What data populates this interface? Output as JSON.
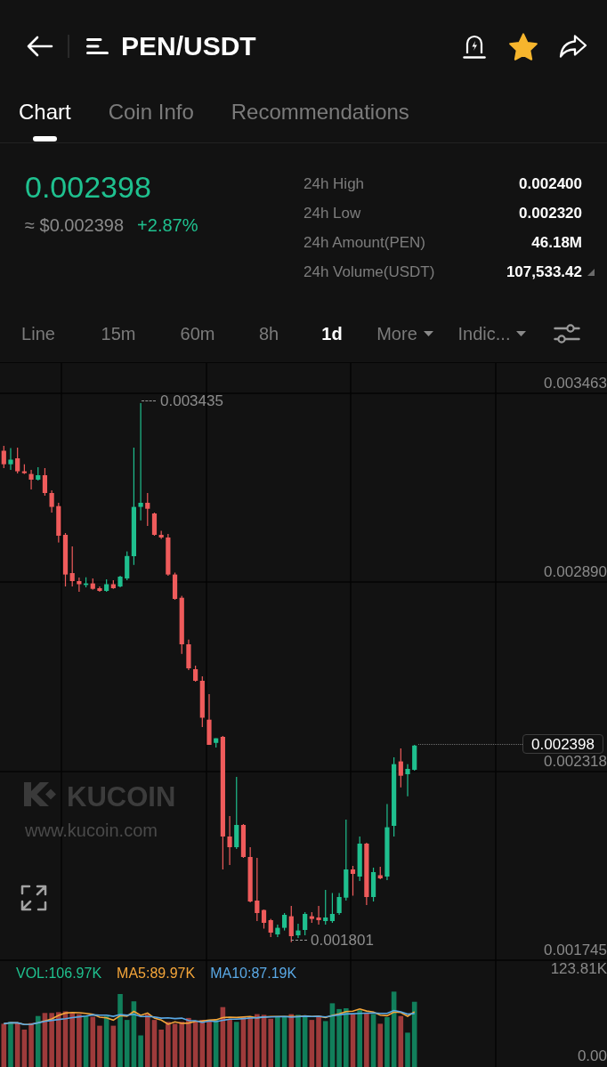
{
  "header": {
    "title": "PEN/USDT",
    "favorite": true
  },
  "tabs": [
    {
      "label": "Chart",
      "selected": true
    },
    {
      "label": "Coin Info",
      "selected": false
    },
    {
      "label": "Recommendations",
      "selected": false
    }
  ],
  "ticker": {
    "price": "0.002398",
    "fiat_price": "≈ $0.002398",
    "change": "+2.87%"
  },
  "stats": [
    {
      "label": "24h High",
      "value": "0.002400",
      "toggle": false
    },
    {
      "label": "24h Low",
      "value": "0.002320",
      "toggle": false
    },
    {
      "label": "24h Amount(PEN)",
      "value": "46.18M",
      "toggle": false
    },
    {
      "label": "24h Volume(USDT)",
      "value": "107,533.42",
      "toggle": true
    }
  ],
  "intervals": [
    {
      "label": "Line",
      "selected": false,
      "dropdown": false
    },
    {
      "label": "15m",
      "selected": false,
      "dropdown": false
    },
    {
      "label": "60m",
      "selected": false,
      "dropdown": false
    },
    {
      "label": "8h",
      "selected": false,
      "dropdown": false
    },
    {
      "label": "1d",
      "selected": true,
      "dropdown": false
    },
    {
      "label": "More",
      "selected": false,
      "dropdown": true
    },
    {
      "label": "Indic...",
      "selected": false,
      "dropdown": true
    }
  ],
  "chart": {
    "price_axis": [
      "0.003463",
      "0.002890",
      "0.002318",
      "0.001745"
    ],
    "high_label": "0.003435",
    "low_label": "0.001801",
    "last_price": "0.002398",
    "watermark": {
      "brand": "KUCOIN",
      "url": "www.kucoin.com"
    }
  },
  "volume": {
    "legend": [
      {
        "label": "VOL:106.97K",
        "color": "#1fc18f"
      },
      {
        "label": "MA5:89.97K",
        "color": "#f5a63a"
      },
      {
        "label": "MA10:87.19K",
        "color": "#5aa9e6"
      }
    ],
    "axis_max": "123.81K",
    "axis_min": "0.00"
  }
}
